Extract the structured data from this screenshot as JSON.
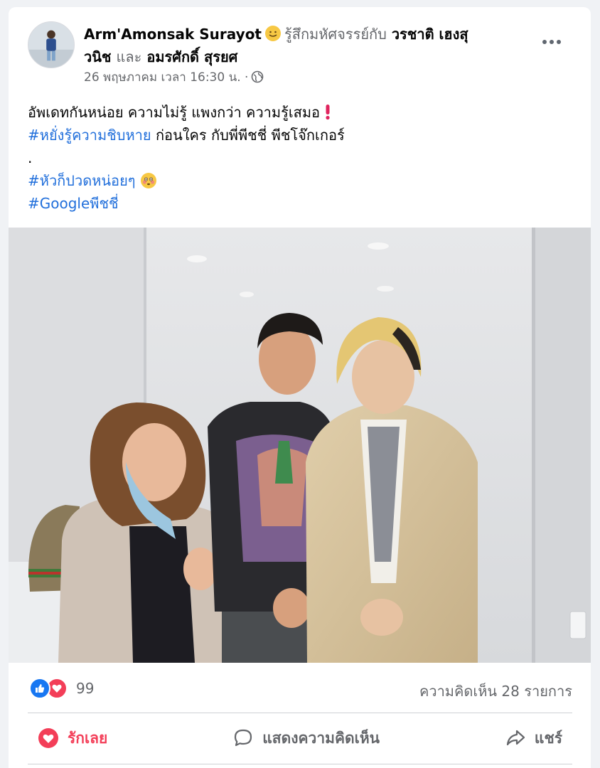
{
  "post": {
    "author": "Arm'Amonsak Surayot",
    "feeling_text": "รู้สึกมหัศจรรย์กับ",
    "tagged_1a": "วรชาติ เฮงสุ",
    "tagged_1b": "วนิช",
    "and_text": "และ",
    "tagged_2": "อมรศักดิ์ สุรยศ",
    "timestamp": "26 พฤษภาคม เวลา 16:30 น. ·",
    "privacy_icon": "globe-icon",
    "text_line_1": "อัพเดทกันหน่อย ความไม่รู้ แพงกว่า ความรู้เสมอ",
    "text_line_2_hashtag": "#หยั่งรู้ความชิบหาย",
    "text_line_2_rest": " ก่อนใคร กับพี่พีชชี่  พีชโจ๊กเกอร์",
    "text_line_3": ".",
    "hashtag_2": "#หัวก็ปวดหน่อยๆ",
    "hashtag_3": "#Googleพีชชี่",
    "emoji_feeling": "smiling-face-icon",
    "emoji_exclaim": "exclamation-icon",
    "emoji_blush": "flushed-face-icon"
  },
  "engagement": {
    "reaction_count": "99",
    "comments_label": "ความคิดเห็น 28 รายการ",
    "reaction_icons": [
      "like-icon",
      "love-icon"
    ]
  },
  "actions": {
    "love_label": "รักเลย",
    "comment_label": "แสดงความคิดเห็น",
    "share_label": "แชร์"
  },
  "colors": {
    "link": "#216fdb",
    "muted": "#65676b",
    "like_blue": "#1877f2",
    "love_red": "#f33e58",
    "background": "#f0f2f5"
  }
}
